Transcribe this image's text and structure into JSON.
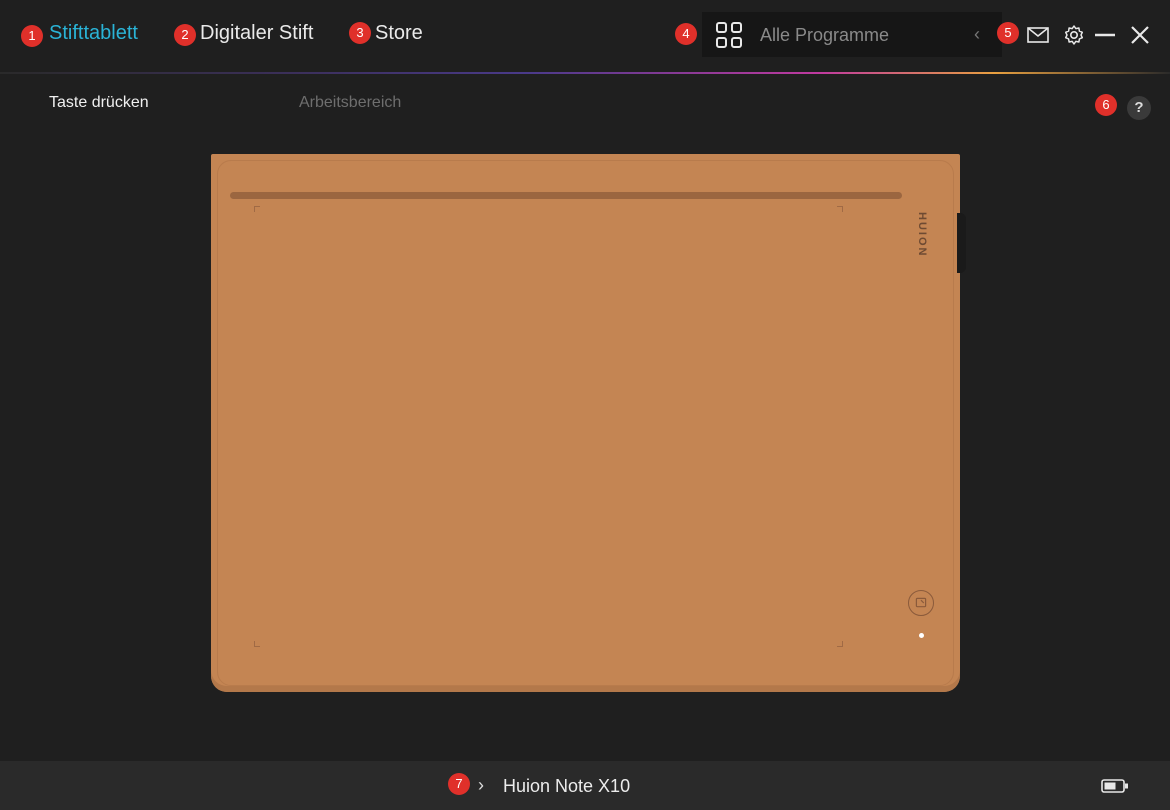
{
  "header": {
    "tabs": [
      {
        "badge": "1",
        "label": "Stifttablett",
        "active": true
      },
      {
        "badge": "2",
        "label": "Digitaler Stift",
        "active": false
      },
      {
        "badge": "3",
        "label": "Store",
        "active": false
      }
    ],
    "program_badge": "4",
    "program_label": "Alle Programme",
    "toolbar_badge": "5"
  },
  "subtabs": [
    {
      "label": "Taste drücken",
      "active": true
    },
    {
      "label": "Arbeitsbereich",
      "active": false
    }
  ],
  "help_badge": "6",
  "help_label": "?",
  "tablet": {
    "brand": "HUION",
    "color": "#c48553"
  },
  "footer": {
    "badge": "7",
    "device_name": "Huion Note X10"
  },
  "colors": {
    "accent": "#2ab3d6",
    "badge": "#e0302a",
    "background": "#1f1f1f"
  },
  "icons": [
    "grid-icon",
    "mail-icon",
    "gear-icon",
    "minimize-icon",
    "close-icon",
    "help-icon",
    "chevron-right-icon",
    "battery-icon"
  ]
}
